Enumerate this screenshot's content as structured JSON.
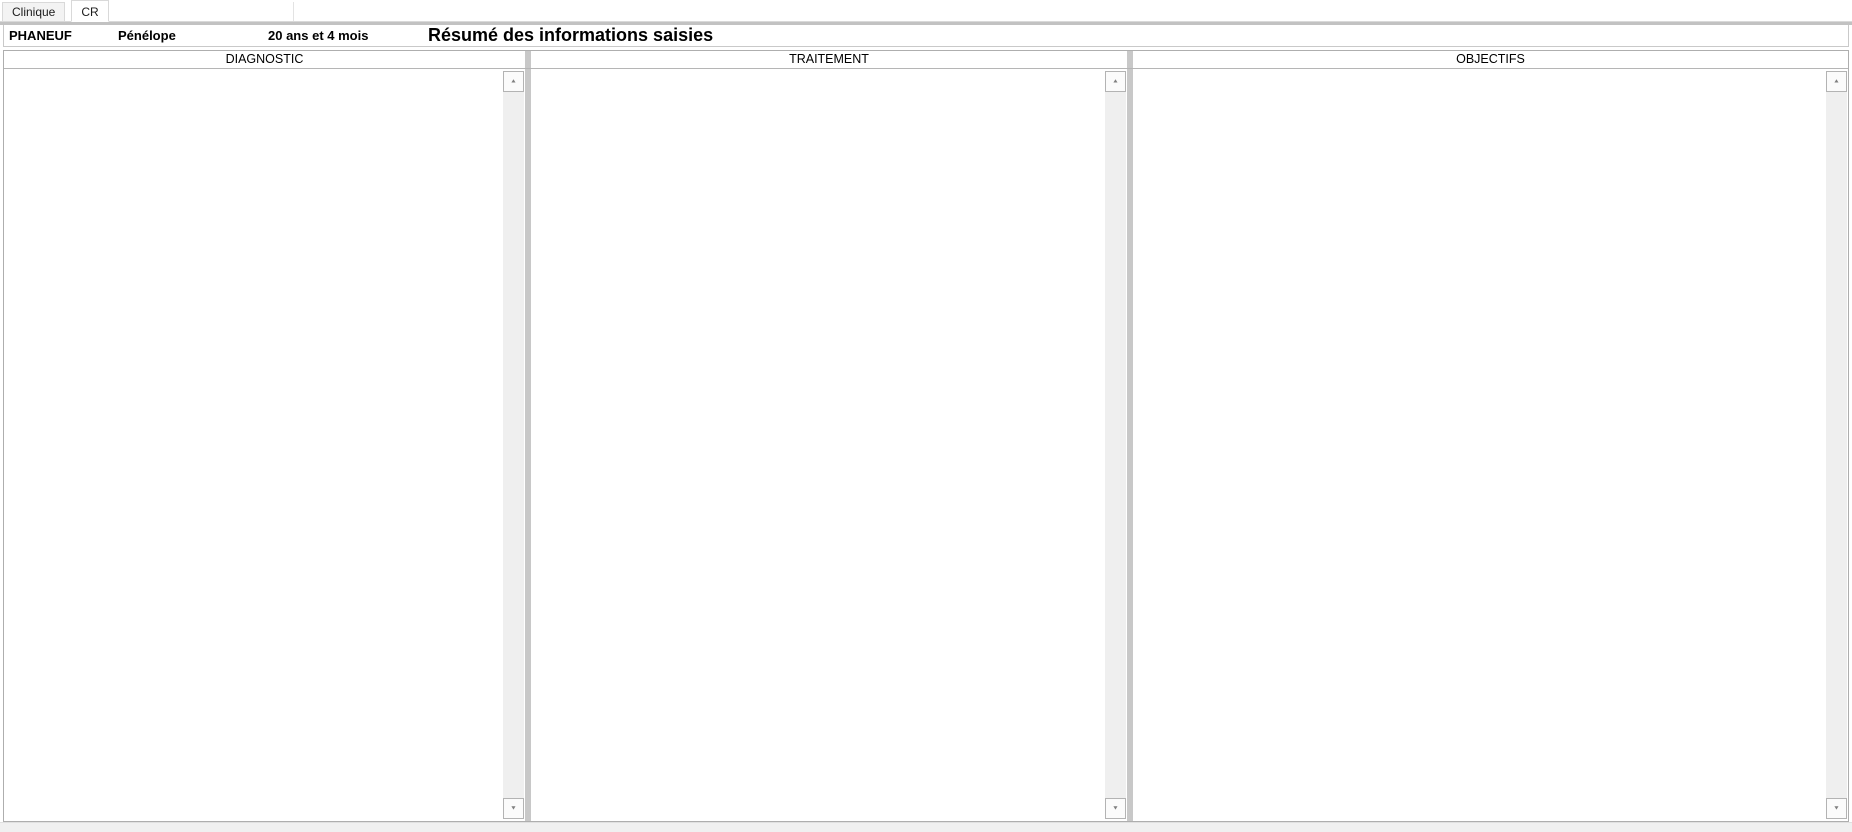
{
  "window": {
    "tabs": [
      {
        "label": "Clinique",
        "active": false
      },
      {
        "label": "CR",
        "active": true
      }
    ]
  },
  "patient": {
    "last_name": "PHANEUF",
    "first_name": "Pénélope",
    "age": "20 ans et 4 mois"
  },
  "page_title": "Résumé des informations saisies",
  "columns": [
    {
      "header": "DIAGNOSTIC",
      "content": ""
    },
    {
      "header": "TRAITEMENT",
      "content": ""
    },
    {
      "header": "OBJECTIFS",
      "content": ""
    }
  ],
  "icons": {
    "scroll_up_icon": "▲",
    "scroll_down_icon": "▼"
  }
}
